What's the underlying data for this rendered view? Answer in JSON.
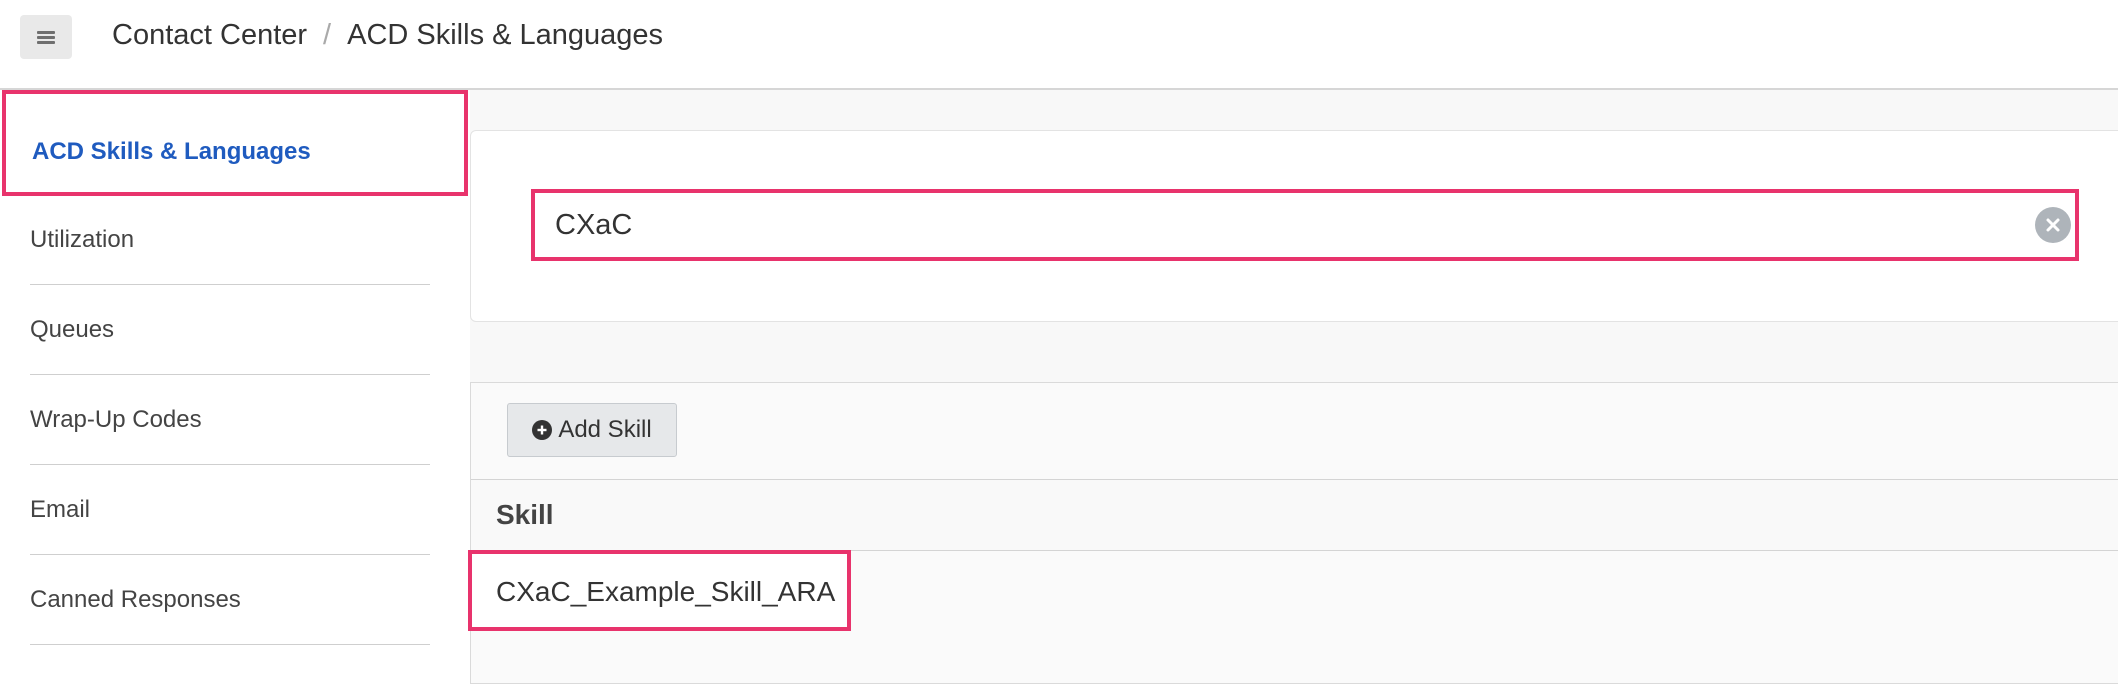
{
  "header": {
    "breadcrumb": [
      "Contact Center",
      "ACD Skills & Languages"
    ],
    "separator": "/"
  },
  "sidebar": {
    "active_item": "ACD Skills & Languages",
    "items": [
      "Utilization",
      "Queues",
      "Wrap-Up Codes",
      "Email",
      "Canned Responses"
    ]
  },
  "search": {
    "value": "CXaC"
  },
  "toolbar": {
    "add_label": "Add Skill"
  },
  "table": {
    "columns": [
      "Skill"
    ],
    "rows": [
      [
        "CXaC_Example_Skill_ARA"
      ]
    ]
  },
  "colors": {
    "highlight": "#e8336c",
    "active_link": "#1f5bbf"
  },
  "icons": {
    "menu": "hamburger-icon",
    "clear": "clear-x-icon",
    "add": "plus-circle-icon"
  }
}
